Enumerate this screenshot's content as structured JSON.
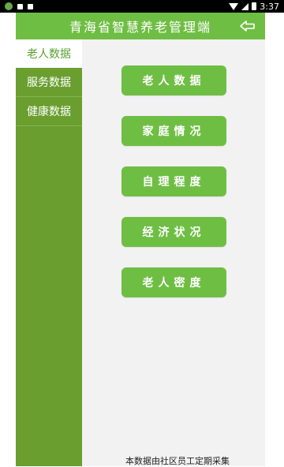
{
  "status_bar": {
    "time": "3:37"
  },
  "header": {
    "title": "青海省智慧养老管理端"
  },
  "sidebar": {
    "active_tab": "老人数据",
    "items": [
      {
        "label": "服务数据"
      },
      {
        "label": "健康数据"
      }
    ]
  },
  "menu": {
    "buttons": [
      {
        "label": "老人数据"
      },
      {
        "label": "家庭情况"
      },
      {
        "label": "自理程度"
      },
      {
        "label": "经济状况"
      },
      {
        "label": "老人密度"
      }
    ]
  },
  "footer": {
    "note": "本数据由社区员工定期采集"
  },
  "colors": {
    "primary": "#6fbe44",
    "sidebar": "#6a9f30",
    "background": "#f2f2f2"
  }
}
